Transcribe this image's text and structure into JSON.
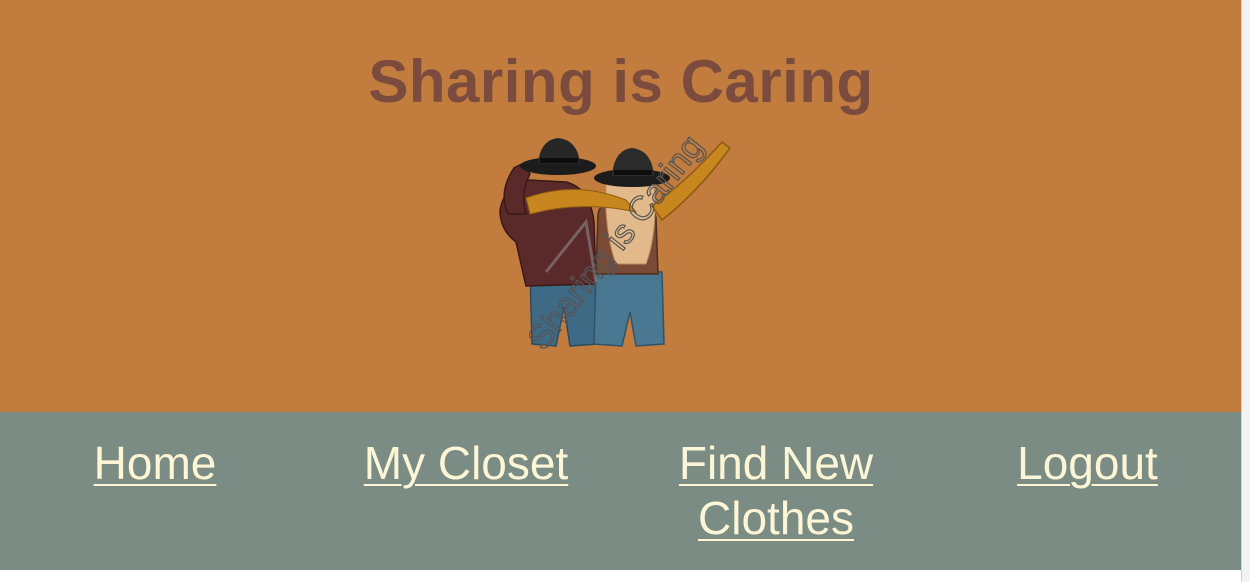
{
  "header": {
    "title": "Sharing is Caring",
    "logo_text": "Sharing is Caring"
  },
  "nav": {
    "home": "Home",
    "my_closet": "My Closet",
    "find_new_clothes": "Find New Clothes",
    "logout": "Logout"
  },
  "colors": {
    "hero_background": "#c17c3e",
    "title_text": "#7b4b3e",
    "nav_background": "#7a8c84",
    "nav_link_text": "#fdf6d6"
  }
}
